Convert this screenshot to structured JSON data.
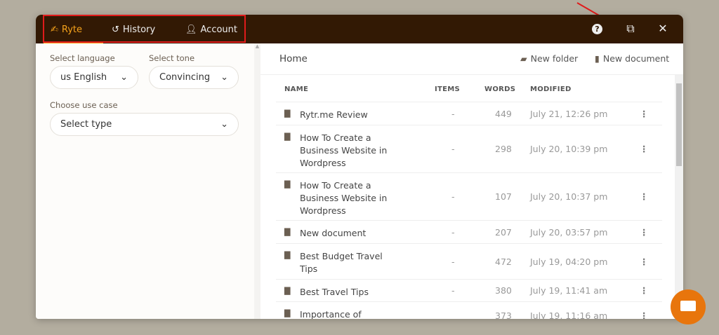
{
  "header": {
    "tabs": [
      {
        "label": "Ryte",
        "icon": "hand-writing-icon"
      },
      {
        "label": "History",
        "icon": "history-icon"
      },
      {
        "label": "Account",
        "icon": "user-icon"
      }
    ],
    "help_icon": "?",
    "external_icon": "⧉",
    "close_icon": "✕"
  },
  "left": {
    "language_label": "Select language",
    "language_value": "us English",
    "tone_label": "Select tone",
    "tone_value": "Convincing",
    "usecase_label": "Choose use case",
    "usecase_placeholder": "Select type"
  },
  "main": {
    "breadcrumb": "Home",
    "new_folder": "New folder",
    "new_document": "New document",
    "columns": [
      "NAME",
      "ITEMS",
      "WORDS",
      "MODIFIED"
    ],
    "rows": [
      {
        "name": "Rytr.me Review",
        "items": "-",
        "words": "449",
        "modified": "July 21, 12:26 pm"
      },
      {
        "name": "How To Create a Business Website in Wordpress",
        "items": "-",
        "words": "298",
        "modified": "July 20, 10:39 pm"
      },
      {
        "name": "How To Create a Business Website in Wordpress",
        "items": "-",
        "words": "107",
        "modified": "July 20, 10:37 pm"
      },
      {
        "name": "New document",
        "items": "-",
        "words": "207",
        "modified": "July 20, 03:57 pm"
      },
      {
        "name": "Best Budget Travel Tips",
        "items": "-",
        "words": "472",
        "modified": "July 19, 04:20 pm"
      },
      {
        "name": "Best Travel Tips",
        "items": "-",
        "words": "380",
        "modified": "July 19, 11:41 am"
      },
      {
        "name": "Importance of",
        "items": "",
        "words": "373",
        "modified": "July 19, 11:16 am"
      }
    ]
  },
  "colors": {
    "header": "#321904",
    "accent": "#f5a21b",
    "chat": "#e8750c",
    "annotation": "#e01b1b"
  }
}
